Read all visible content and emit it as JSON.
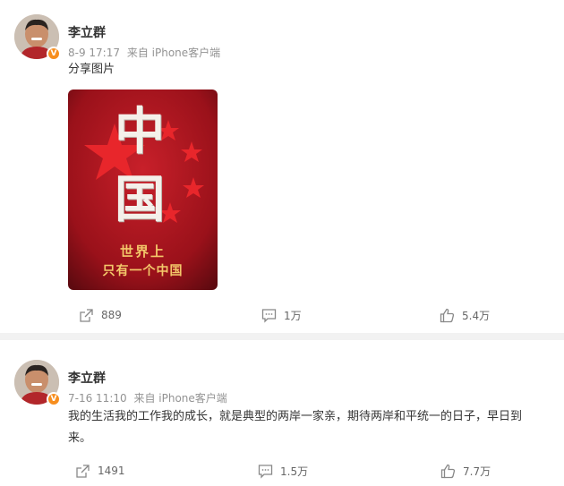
{
  "posts": [
    {
      "author": "李立群",
      "time": "8-9 17:17",
      "source": "来自 iPhone客户端",
      "text": "分享图片",
      "image": {
        "big_char_1": "中",
        "big_char_2": "国",
        "caption_line1": "世界上",
        "caption_line2": "只有一个中国"
      },
      "repost_count": "889",
      "comment_count": "1万",
      "like_count": "5.4万"
    },
    {
      "author": "李立群",
      "time": "7-16 11:10",
      "source": "来自 iPhone客户端",
      "text": "我的生活我的工作我的成长，就是典型的两岸一家亲，期待两岸和平统一的日子，早日到来。",
      "repost_count": "1491",
      "comment_count": "1.5万",
      "like_count": "7.7万"
    }
  ],
  "icons": {
    "repost": "share-icon",
    "comment": "comment-icon",
    "like": "thumbs-up-icon",
    "verified": "verified-badge-icon"
  },
  "badge_text": "V",
  "colors": {
    "badge": "#f78e1e",
    "image_red": "#b11620",
    "caption_gold": "#f3c76a"
  }
}
